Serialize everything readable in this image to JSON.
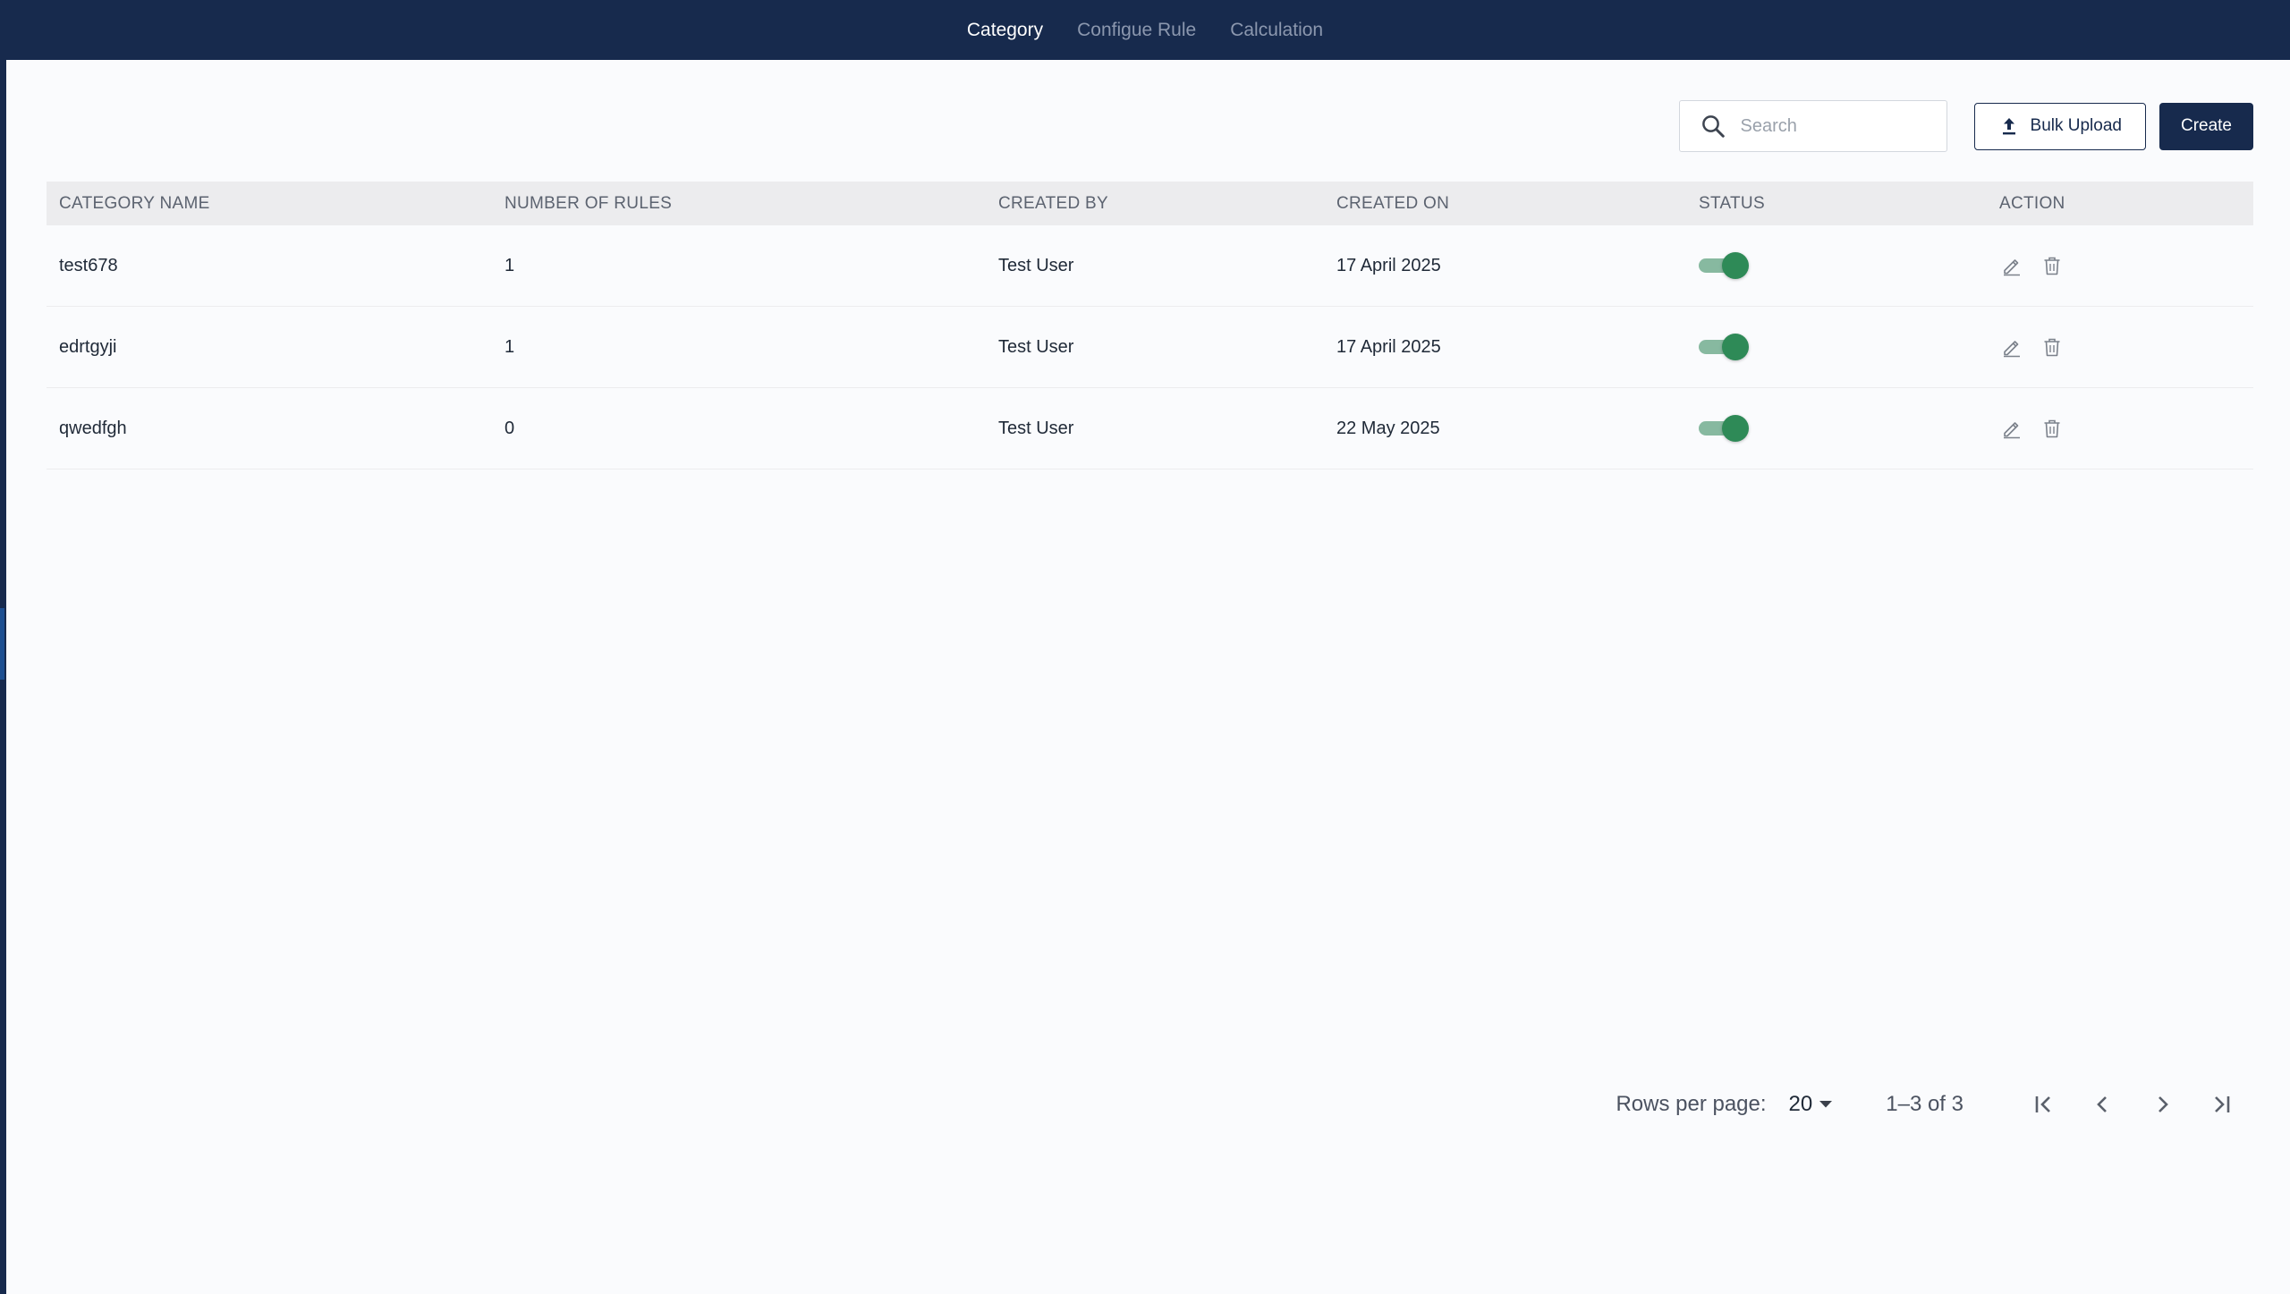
{
  "nav": {
    "tabs": [
      {
        "label": "Category",
        "active": true
      },
      {
        "label": "Configue Rule",
        "active": false
      },
      {
        "label": "Calculation",
        "active": false
      }
    ]
  },
  "toolbar": {
    "search_placeholder": "Search",
    "search_value": "",
    "bulk_upload_label": "Bulk Upload",
    "create_label": "Create"
  },
  "table": {
    "columns": [
      "CATEGORY NAME",
      "NUMBER OF RULES",
      "CREATED BY",
      "CREATED ON",
      "STATUS",
      "ACTION"
    ],
    "rows": [
      {
        "name": "test678",
        "rules": "1",
        "created_by": "Test User",
        "created_on": "17 April 2025",
        "status_on": true
      },
      {
        "name": "edrtgyji",
        "rules": "1",
        "created_by": "Test User",
        "created_on": "17 April 2025",
        "status_on": true
      },
      {
        "name": "qwedfgh",
        "rules": "0",
        "created_by": "Test User",
        "created_on": "22 May 2025",
        "status_on": true
      }
    ]
  },
  "pagination": {
    "rows_per_page_label": "Rows per page:",
    "rows_per_page_value": "20",
    "range_text": "1–3 of 3"
  },
  "colors": {
    "nav_background": "#172a4d",
    "primary": "#172a4d",
    "toggle_on": "#2e8a57",
    "header_background": "#ececee"
  },
  "icons": {
    "search": "search-icon",
    "upload": "upload-icon",
    "edit": "pencil-icon",
    "delete": "trash-icon",
    "dropdown": "caret-down-icon",
    "first": "first-page-icon",
    "prev": "chevron-left-icon",
    "next": "chevron-right-icon",
    "last": "last-page-icon"
  }
}
